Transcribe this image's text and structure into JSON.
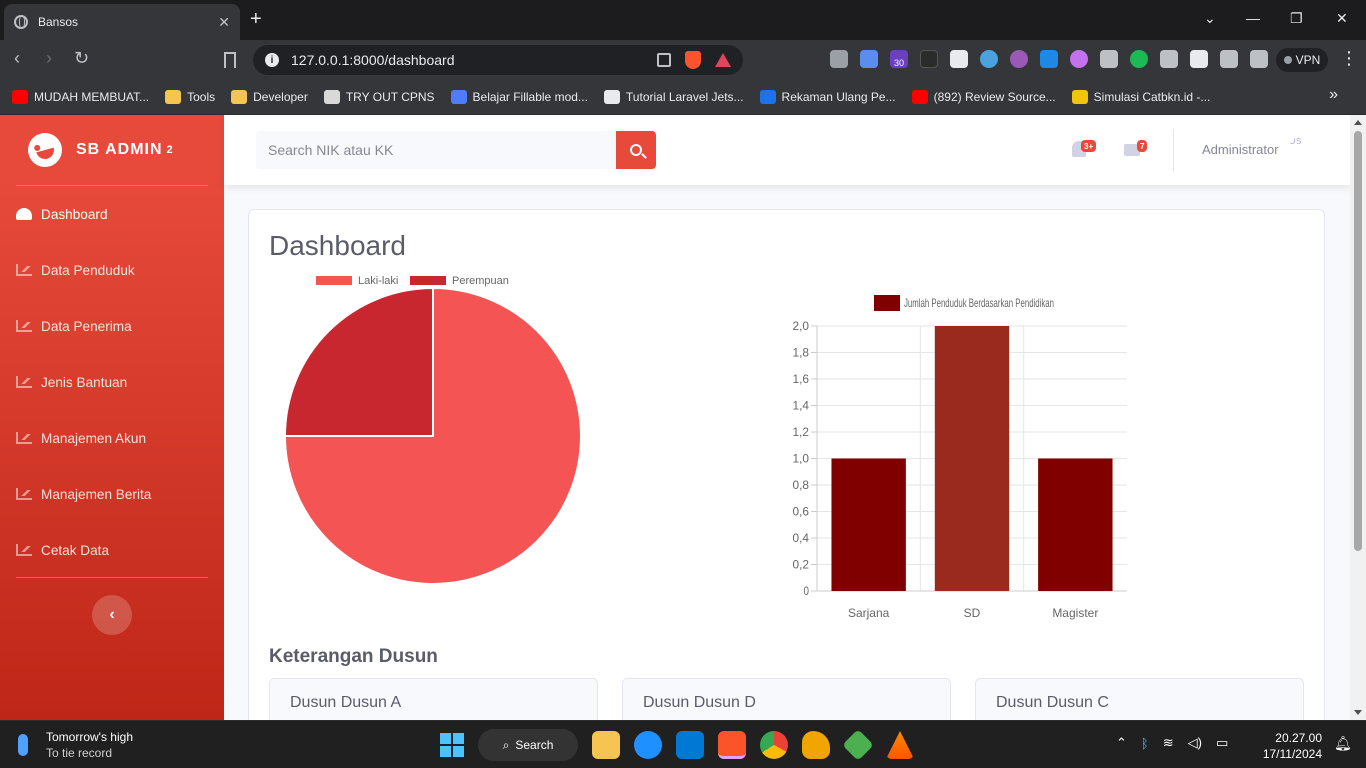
{
  "browser": {
    "tab_title": "Bansos",
    "url": "127.0.0.1:8000/dashboard",
    "new_tab_glyph": "+",
    "close_glyph": "✕",
    "vpn_label": "VPN",
    "extension_badge": "30",
    "bookmarks": [
      {
        "label": "MUDAH MEMBUAT...",
        "icon": "youtube-icon",
        "color": "#ff0000"
      },
      {
        "label": "Tools",
        "icon": "folder-icon",
        "color": "#f5c451"
      },
      {
        "label": "Developer",
        "icon": "folder-icon",
        "color": "#f5c451"
      },
      {
        "label": "TRY OUT CPNS",
        "icon": "emblem-icon",
        "color": "#d9d9d9"
      },
      {
        "label": "Belajar Fillable mod...",
        "icon": "wave-icon",
        "color": "#4e7cff"
      },
      {
        "label": "Tutorial Laravel Jets...",
        "icon": "github-icon",
        "color": "#e8eaed"
      },
      {
        "label": "Rekaman Ulang Pe...",
        "icon": "a-icon",
        "color": "#1a73e8"
      },
      {
        "label": "(892) Review Source...",
        "icon": "youtube-icon",
        "color": "#ff0000"
      },
      {
        "label": "Simulasi Catbkn.id -...",
        "icon": "cat-icon",
        "color": "#f1c40f"
      }
    ]
  },
  "app": {
    "brand": "SB ADMIN",
    "brand_sup": "2",
    "search_placeholder": "Search NIK atau KK",
    "alerts_badge": "3+",
    "messages_badge": "7",
    "user_name": "Administrator",
    "avatar_alt": "Us",
    "toggle_glyph": "‹",
    "nav": [
      {
        "label": "Dashboard",
        "icon": "tachometer-icon",
        "active": true
      },
      {
        "label": "Data Penduduk",
        "icon": "chart-area-icon"
      },
      {
        "label": "Data Penerima",
        "icon": "chart-area-icon"
      },
      {
        "label": "Jenis Bantuan",
        "icon": "chart-area-icon"
      },
      {
        "label": "Manajemen Akun",
        "icon": "chart-area-icon"
      },
      {
        "label": "Manajemen Berita",
        "icon": "chart-area-icon"
      },
      {
        "label": "Cetak Data",
        "icon": "chart-area-icon"
      }
    ],
    "page_title": "Dashboard",
    "section_title": "Keterangan Dusun",
    "dusun_cards": [
      "Dusun Dusun A",
      "Dusun Dusun D",
      "Dusun Dusun C"
    ]
  },
  "chart_data": [
    {
      "type": "pie",
      "legend_position": "top",
      "slices": [
        {
          "label": "Laki-laki",
          "value": 3,
          "color": "#f55454"
        },
        {
          "label": "Perempuan",
          "value": 1,
          "color": "#c8272f"
        }
      ]
    },
    {
      "type": "bar",
      "categories": [
        "Sarjana",
        "SD",
        "Magister"
      ],
      "series": [
        {
          "name": "Jumlah Penduduk Berdasarkan Pendidikan",
          "values": [
            1,
            2,
            1
          ],
          "colors": [
            "#800000",
            "#9b2a1e",
            "#800000"
          ]
        }
      ],
      "ylim": [
        0,
        2
      ],
      "yticks": [
        "0",
        "0,2",
        "0,4",
        "0,6",
        "0,8",
        "1,0",
        "1,2",
        "1,4",
        "1,6",
        "1,8",
        "2,0"
      ],
      "legend_position": "top",
      "grid": true
    }
  ],
  "taskbar": {
    "weather_title": "Tomorrow's high",
    "weather_sub": "To tie record",
    "search_label": "Search",
    "time": "20.27.00",
    "date": "17/11/2024"
  }
}
